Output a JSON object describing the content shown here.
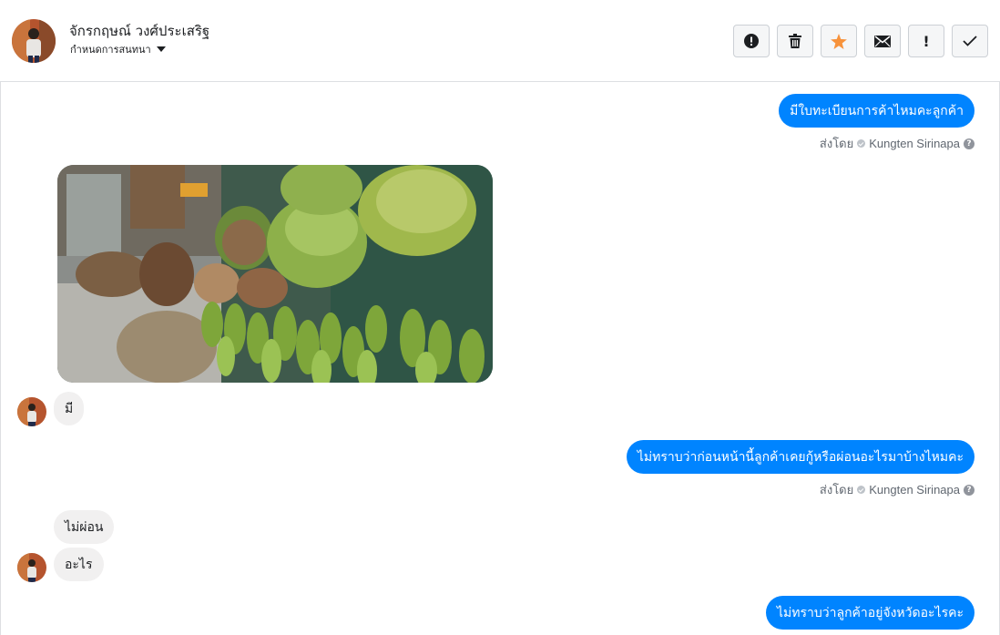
{
  "header": {
    "contact_name": "จักรกฤษณ์ วงศ์ประเสริฐ",
    "conversation_settings": "กำหนดการสนทนา",
    "actions": [
      {
        "name": "spam",
        "icon": "alert-circle-icon"
      },
      {
        "name": "delete",
        "icon": "trash-icon"
      },
      {
        "name": "star",
        "icon": "star-icon",
        "color": "#f7923b"
      },
      {
        "name": "mark-unread",
        "icon": "envelope-icon"
      },
      {
        "name": "important",
        "icon": "exclamation-icon",
        "label": "!"
      },
      {
        "name": "done",
        "icon": "check-icon"
      }
    ]
  },
  "messages": {
    "m1": {
      "text": "มีใบทะเบียนการค้าไหมคะลูกค้า",
      "sent_by_label": "ส่งโดย",
      "sender": "Kungten Sirinapa"
    },
    "m2": {
      "type": "image",
      "description_icon": "coconut-banana-photo"
    },
    "m3": {
      "text": "มี"
    },
    "m4": {
      "text": "ไม่ทราบว่าก่อนหน้านี้ลูกค้าเคยกู้หรือผ่อนอะไรมาบ้างไหมคะ",
      "sent_by_label": "ส่งโดย",
      "sender": "Kungten Sirinapa"
    },
    "m5": {
      "text": "ไม่ผ่อน"
    },
    "m6": {
      "text": "อะไร"
    },
    "m7": {
      "text": "ไม่ทราบว่าลูกค้าอยู่จังหวัดอะไรคะ"
    }
  },
  "colors": {
    "accent": "#0084ff",
    "incoming_bg": "#f1f0f0",
    "star": "#f7923b"
  }
}
